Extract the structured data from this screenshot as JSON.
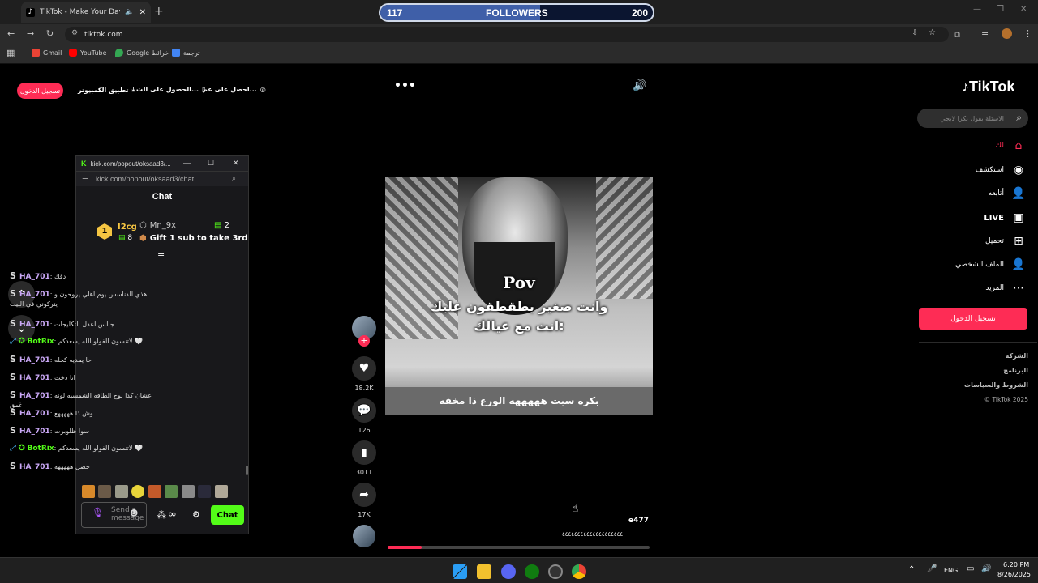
{
  "browser": {
    "tab_title": "TikTok - Make Your Day",
    "url": "tiktok.com",
    "bookmarks": [
      "Gmail",
      "YouTube",
      "Google خرائط",
      "ترجمة"
    ]
  },
  "followers_goal": {
    "current": "117",
    "label": "FOLLOWERS",
    "target": "200",
    "progress_fraction": 0.585
  },
  "tiktok_top": {
    "login": "تسجيل الدخول",
    "items": [
      "تطبيق الكمبيوتر",
      "الحصول على الت...",
      "احصل على عم..."
    ]
  },
  "tiktok_sidebar": {
    "logo": "TikTok",
    "search_placeholder": "الاسئلة بقول بكرا لابجي",
    "nav": [
      {
        "label": "لك",
        "icon": "home-icon"
      },
      {
        "label": "استكشف",
        "icon": "compass-icon"
      },
      {
        "label": "أتابعه",
        "icon": "user-follow-icon"
      },
      {
        "label": "LIVE",
        "icon": "live-icon"
      },
      {
        "label": "تحميل",
        "icon": "upload-icon"
      },
      {
        "label": "الملف الشخصي",
        "icon": "profile-icon"
      },
      {
        "label": "المزيد",
        "icon": "more-icon"
      }
    ],
    "login": "تسجيل الدخول",
    "footer": [
      "الشركة",
      "البرنامج",
      "الشروط والسياسات",
      "© TikTok 2025"
    ]
  },
  "video": {
    "overlay_pov": "Pov",
    "overlay_line1": "وانت صغير يطقطقون عليك",
    "overlay_line2": "انت مع عيالك:",
    "caption": "بكره سبت هههههه الورع ذا مخفه",
    "author": "e477",
    "description": "٤٤٤٤٤٤٤٤٤٤٤٤٤٤٤٤٤٤٤٤",
    "progress_fraction": 0.13,
    "likes": "18.2K",
    "comments": "126",
    "saves": "3011",
    "shares": "17K"
  },
  "kick_popout": {
    "window_title": "kick.com/popout/oksaad3/...",
    "url": "kick.com/popout/oksaad3/chat",
    "chat_title": "Chat",
    "leaderboard": {
      "rank1_name": "I2cg",
      "rank1_subs": "8",
      "rank2_name": "Mn_9x",
      "rank2_subs": "2",
      "rank3_text": "Gift 1 sub to take 3rd"
    },
    "messages": [
      {
        "user": "HA_701",
        "text": "دقك",
        "color": "#c9a7f5",
        "badge": "S"
      },
      {
        "user": "HA_701",
        "text": "هذي الذناسس يوم اهلي يروحون و يتركوني في البيت",
        "color": "#c9a7f5",
        "badge": "S"
      },
      {
        "user": "HA_701",
        "text": "جالس اعدل التكليجات",
        "color": "#c9a7f5",
        "badge": "S"
      },
      {
        "user": "BotRix",
        "text": "لاتنسون الفولو الله يسعدكم 🤍",
        "color": "#53fc18",
        "badge": "bot"
      },
      {
        "user": "HA_701",
        "text": "حا يمديه كحله",
        "color": "#c9a7f5",
        "badge": "S"
      },
      {
        "user": "HA_701",
        "text": "انا دخت",
        "color": "#c9a7f5",
        "badge": "S"
      },
      {
        "user": "HA_701",
        "text": "عشان كذا لوح الطاقه الشمسيه لونه غمق",
        "color": "#c9a7f5",
        "badge": "S"
      },
      {
        "user": "HA_701",
        "text": "وش ذا هههههع",
        "color": "#c9a7f5",
        "badge": "S"
      },
      {
        "user": "HA_701",
        "text": "سوا ظلوبرت",
        "color": "#c9a7f5",
        "badge": "S"
      },
      {
        "user": "BotRix",
        "text": "لاتنسون الفولو الله يسعدكم 🤍",
        "color": "#53fc18",
        "badge": "bot"
      },
      {
        "user": "HA_701",
        "text": "حصل هههههه",
        "color": "#c9a7f5",
        "badge": "S"
      }
    ],
    "send_placeholder": "Send a message",
    "chat_button": "Chat"
  },
  "taskbar": {
    "language": "ENG",
    "time": "6:20 PM",
    "date": "8/26/2025"
  }
}
